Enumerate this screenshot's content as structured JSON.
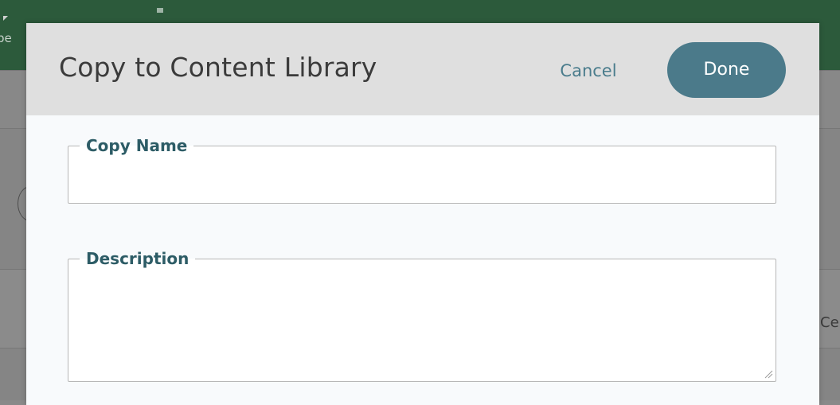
{
  "background": {
    "header_text": "pe",
    "right_text": "Ce"
  },
  "modal": {
    "title": "Copy to Content Library",
    "cancel_label": "Cancel",
    "done_label": "Done"
  },
  "fields": {
    "copy_name": {
      "label": "Copy Name",
      "value": "",
      "placeholder": ""
    },
    "description": {
      "label": "Description",
      "value": "",
      "placeholder": ""
    }
  },
  "colors": {
    "done_button": "#4b7a8a",
    "cancel_text": "#4a7c8c",
    "field_label": "#2d5c66",
    "header_bg": "#dfdfdf",
    "app_header": "#2c5a3b"
  },
  "icons": {
    "resize_grip": "resize-grip-icon"
  }
}
